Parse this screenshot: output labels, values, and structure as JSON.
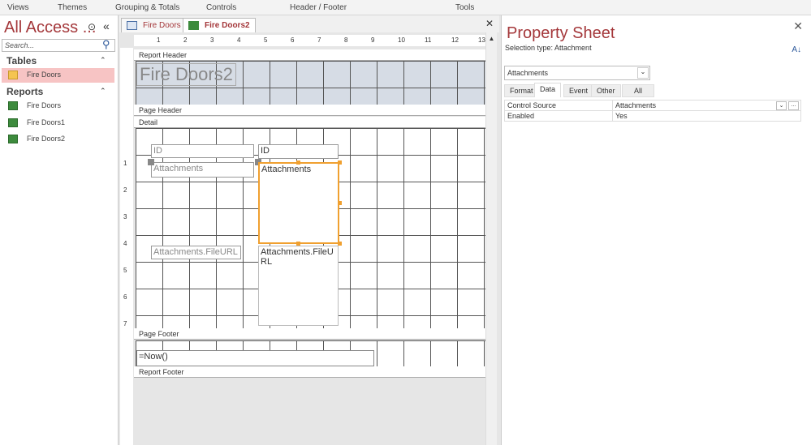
{
  "ribbon": {
    "groups": [
      "Views",
      "Themes",
      "Grouping & Totals",
      "Controls",
      "Header / Footer",
      "Tools"
    ]
  },
  "nav": {
    "title": "All Access ...",
    "search_placeholder": "Search...",
    "tables_label": "Tables",
    "tables": [
      "Fire Doors"
    ],
    "reports_label": "Reports",
    "reports": [
      "Fire Doors",
      "Fire Doors1",
      "Fire Doors2"
    ]
  },
  "tabs": [
    "Fire Doors",
    "Fire Doors2"
  ],
  "ruler": [
    "1",
    "2",
    "3",
    "4",
    "5",
    "6",
    "7",
    "8",
    "9",
    "10",
    "11",
    "12",
    "13"
  ],
  "vruler": [
    "1",
    "2",
    "3",
    "4",
    "5",
    "6",
    "7"
  ],
  "design": {
    "report_header": "Report Header",
    "title": "Fire Doors2",
    "page_header": "Page Header",
    "detail": "Detail",
    "id_label": "ID",
    "id_field": "ID",
    "att_label": "Attachments",
    "att_field": "Attachments",
    "url_label": "Attachments.FileURL",
    "url_field": "Attachments.FileURL",
    "page_footer": "Page Footer",
    "now": "=Now()",
    "report_footer": "Report Footer"
  },
  "property_sheet": {
    "title": "Property Sheet",
    "selection_type": "Selection type:  Attachment",
    "selected_control": "Attachments",
    "tabs": [
      "Format",
      "Data",
      "Event",
      "Other",
      "All"
    ],
    "active_tab": "Data",
    "rows": [
      {
        "name": "Control Source",
        "value": "Attachments"
      },
      {
        "name": "Enabled",
        "value": "Yes"
      }
    ]
  }
}
